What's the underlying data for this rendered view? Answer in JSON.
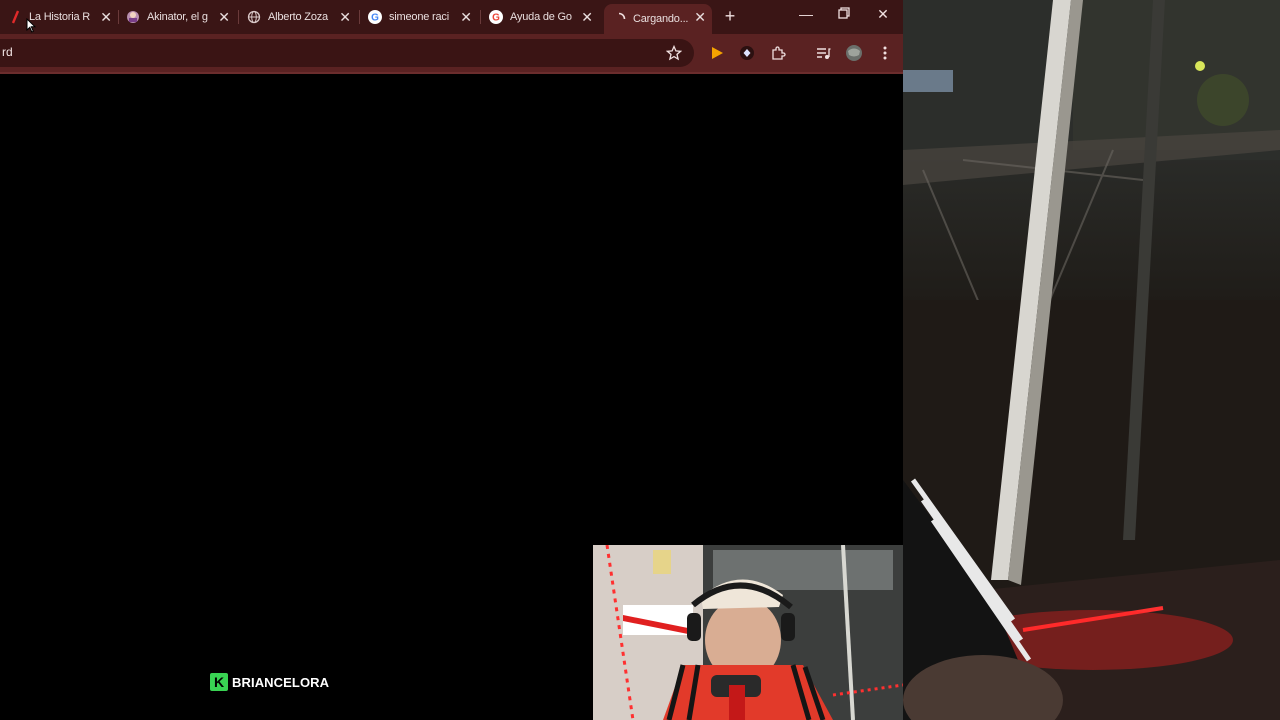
{
  "browser": {
    "tabs": [
      {
        "title": "La Historia R",
        "favicon": "red-slash-icon"
      },
      {
        "title": "Akinator, el g",
        "favicon": "akinator-icon"
      },
      {
        "title": "Alberto Zoza",
        "favicon": "globe-icon"
      },
      {
        "title": "simeone raci",
        "favicon": "google-icon"
      },
      {
        "title": "Ayuda de Go",
        "favicon": "google-icon"
      },
      {
        "title": "Cargando...",
        "favicon": "loading-spinner-icon"
      }
    ],
    "address_text": "rd",
    "colors": {
      "tabstrip": "#3a1515",
      "toolbar": "#5a2222",
      "page": "#000000"
    }
  },
  "overlay": {
    "channel_name": "BRIANCELORA",
    "logo_letter": "K",
    "logo_color": "#39d353"
  }
}
